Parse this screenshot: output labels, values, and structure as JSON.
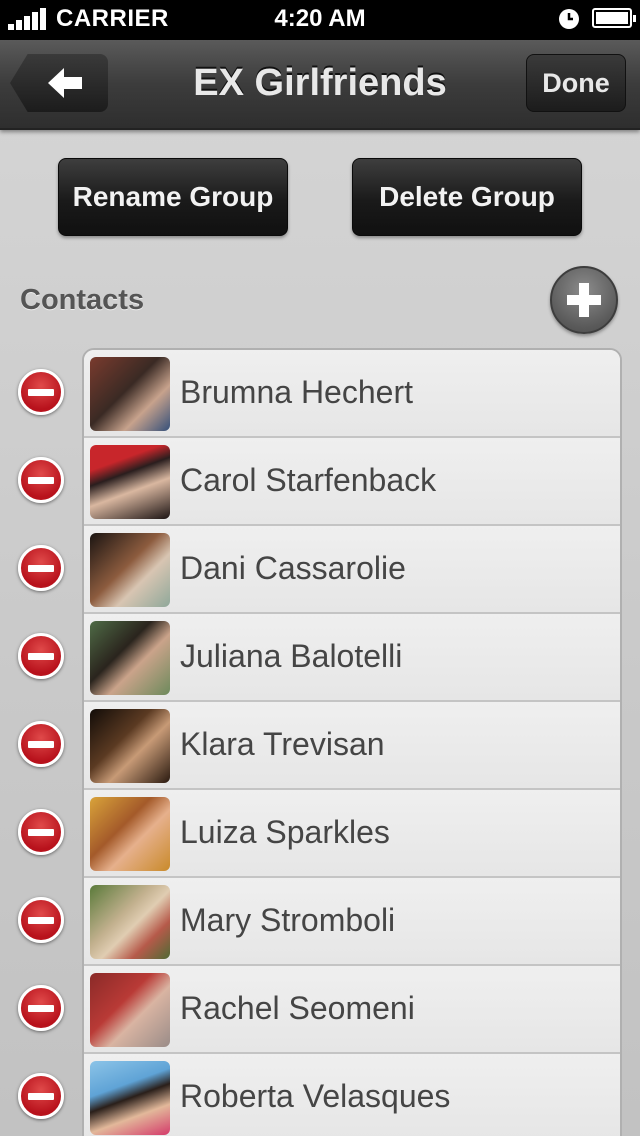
{
  "status_bar": {
    "carrier": "CARRIER",
    "time": "4:20 AM"
  },
  "nav": {
    "title": "EX Girlfriends",
    "done_label": "Done",
    "back_icon": "arrow-left-icon"
  },
  "actions": {
    "rename_label": "Rename Group",
    "delete_label": "Delete Group"
  },
  "contacts": {
    "header": "Contacts",
    "add_icon": "plus-icon",
    "items": [
      {
        "name": "Brumna Hechert"
      },
      {
        "name": "Carol Starfenback"
      },
      {
        "name": "Dani Cassarolie"
      },
      {
        "name": "Juliana Balotelli"
      },
      {
        "name": "Klara Trevisan"
      },
      {
        "name": "Luiza Sparkles"
      },
      {
        "name": "Mary Stromboli"
      },
      {
        "name": "Rachel Seomeni"
      },
      {
        "name": "Roberta Velasques"
      }
    ]
  },
  "colors": {
    "remove": "#c4161f",
    "nav_dark": "#3c3c3c",
    "background": "#cfcfcf"
  }
}
